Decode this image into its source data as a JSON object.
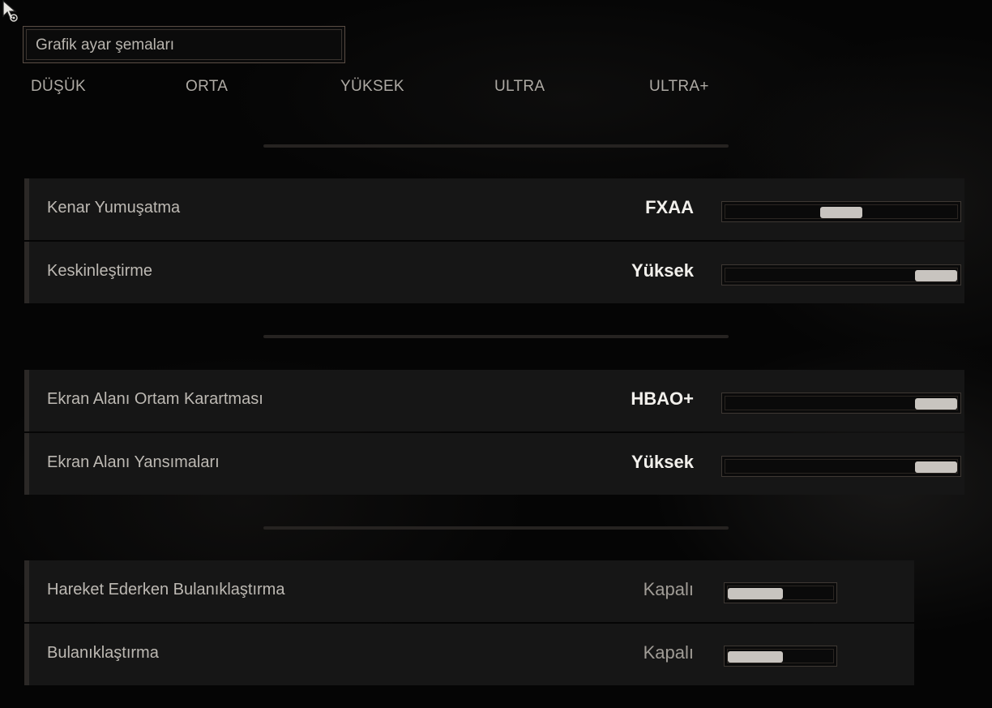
{
  "presets": {
    "title": "Grafik ayar şemaları",
    "options": [
      "DÜŞÜK",
      "ORTA",
      "YÜKSEK",
      "ULTRA",
      "ULTRA+"
    ]
  },
  "settings": [
    {
      "label": "Kenar Yumuşatma",
      "value": "FXAA",
      "level": 0.5
    },
    {
      "label": "Keskinleştirme",
      "value": "Yüksek",
      "level": 1.0
    },
    {
      "label": "Ekran Alanı Ortam Karartması",
      "value": "HBAO+",
      "level": 1.0
    },
    {
      "label": "Ekran Alanı Yansımaları",
      "value": "Yüksek",
      "level": 1.0
    },
    {
      "label": "Hareket Ederken Bulanıklaştırma",
      "value": "Kapalı",
      "level": 0.0
    },
    {
      "label": "Bulanıklaştırma",
      "value": "Kapalı",
      "level": 0.0
    }
  ],
  "colors": {
    "background": "#050505",
    "row": "#161616",
    "thumb": "#c8c4bf",
    "value_active": "#f2f0ec",
    "value_off": "#a09c96"
  },
  "icons": [
    "mouse-pointer-icon"
  ]
}
